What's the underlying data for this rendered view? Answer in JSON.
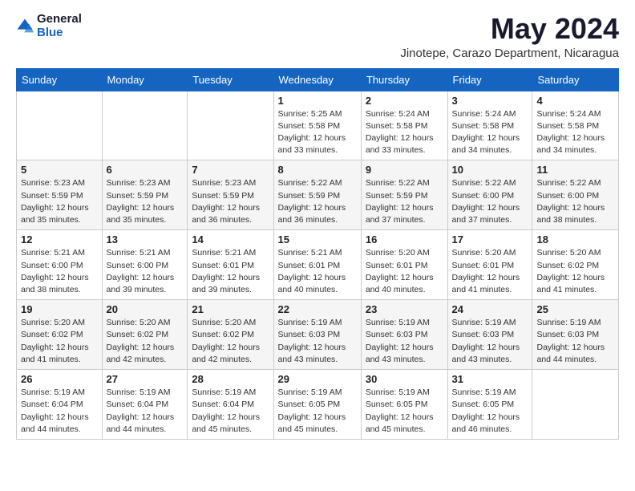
{
  "logo": {
    "general": "General",
    "blue": "Blue"
  },
  "title": "May 2024",
  "location": "Jinotepe, Carazo Department, Nicaragua",
  "weekdays": [
    "Sunday",
    "Monday",
    "Tuesday",
    "Wednesday",
    "Thursday",
    "Friday",
    "Saturday"
  ],
  "weeks": [
    [
      {
        "day": "",
        "info": ""
      },
      {
        "day": "",
        "info": ""
      },
      {
        "day": "",
        "info": ""
      },
      {
        "day": "1",
        "info": "Sunrise: 5:25 AM\nSunset: 5:58 PM\nDaylight: 12 hours\nand 33 minutes."
      },
      {
        "day": "2",
        "info": "Sunrise: 5:24 AM\nSunset: 5:58 PM\nDaylight: 12 hours\nand 33 minutes."
      },
      {
        "day": "3",
        "info": "Sunrise: 5:24 AM\nSunset: 5:58 PM\nDaylight: 12 hours\nand 34 minutes."
      },
      {
        "day": "4",
        "info": "Sunrise: 5:24 AM\nSunset: 5:58 PM\nDaylight: 12 hours\nand 34 minutes."
      }
    ],
    [
      {
        "day": "5",
        "info": "Sunrise: 5:23 AM\nSunset: 5:59 PM\nDaylight: 12 hours\nand 35 minutes."
      },
      {
        "day": "6",
        "info": "Sunrise: 5:23 AM\nSunset: 5:59 PM\nDaylight: 12 hours\nand 35 minutes."
      },
      {
        "day": "7",
        "info": "Sunrise: 5:23 AM\nSunset: 5:59 PM\nDaylight: 12 hours\nand 36 minutes."
      },
      {
        "day": "8",
        "info": "Sunrise: 5:22 AM\nSunset: 5:59 PM\nDaylight: 12 hours\nand 36 minutes."
      },
      {
        "day": "9",
        "info": "Sunrise: 5:22 AM\nSunset: 5:59 PM\nDaylight: 12 hours\nand 37 minutes."
      },
      {
        "day": "10",
        "info": "Sunrise: 5:22 AM\nSunset: 6:00 PM\nDaylight: 12 hours\nand 37 minutes."
      },
      {
        "day": "11",
        "info": "Sunrise: 5:22 AM\nSunset: 6:00 PM\nDaylight: 12 hours\nand 38 minutes."
      }
    ],
    [
      {
        "day": "12",
        "info": "Sunrise: 5:21 AM\nSunset: 6:00 PM\nDaylight: 12 hours\nand 38 minutes."
      },
      {
        "day": "13",
        "info": "Sunrise: 5:21 AM\nSunset: 6:00 PM\nDaylight: 12 hours\nand 39 minutes."
      },
      {
        "day": "14",
        "info": "Sunrise: 5:21 AM\nSunset: 6:01 PM\nDaylight: 12 hours\nand 39 minutes."
      },
      {
        "day": "15",
        "info": "Sunrise: 5:21 AM\nSunset: 6:01 PM\nDaylight: 12 hours\nand 40 minutes."
      },
      {
        "day": "16",
        "info": "Sunrise: 5:20 AM\nSunset: 6:01 PM\nDaylight: 12 hours\nand 40 minutes."
      },
      {
        "day": "17",
        "info": "Sunrise: 5:20 AM\nSunset: 6:01 PM\nDaylight: 12 hours\nand 41 minutes."
      },
      {
        "day": "18",
        "info": "Sunrise: 5:20 AM\nSunset: 6:02 PM\nDaylight: 12 hours\nand 41 minutes."
      }
    ],
    [
      {
        "day": "19",
        "info": "Sunrise: 5:20 AM\nSunset: 6:02 PM\nDaylight: 12 hours\nand 41 minutes."
      },
      {
        "day": "20",
        "info": "Sunrise: 5:20 AM\nSunset: 6:02 PM\nDaylight: 12 hours\nand 42 minutes."
      },
      {
        "day": "21",
        "info": "Sunrise: 5:20 AM\nSunset: 6:02 PM\nDaylight: 12 hours\nand 42 minutes."
      },
      {
        "day": "22",
        "info": "Sunrise: 5:19 AM\nSunset: 6:03 PM\nDaylight: 12 hours\nand 43 minutes."
      },
      {
        "day": "23",
        "info": "Sunrise: 5:19 AM\nSunset: 6:03 PM\nDaylight: 12 hours\nand 43 minutes."
      },
      {
        "day": "24",
        "info": "Sunrise: 5:19 AM\nSunset: 6:03 PM\nDaylight: 12 hours\nand 43 minutes."
      },
      {
        "day": "25",
        "info": "Sunrise: 5:19 AM\nSunset: 6:03 PM\nDaylight: 12 hours\nand 44 minutes."
      }
    ],
    [
      {
        "day": "26",
        "info": "Sunrise: 5:19 AM\nSunset: 6:04 PM\nDaylight: 12 hours\nand 44 minutes."
      },
      {
        "day": "27",
        "info": "Sunrise: 5:19 AM\nSunset: 6:04 PM\nDaylight: 12 hours\nand 44 minutes."
      },
      {
        "day": "28",
        "info": "Sunrise: 5:19 AM\nSunset: 6:04 PM\nDaylight: 12 hours\nand 45 minutes."
      },
      {
        "day": "29",
        "info": "Sunrise: 5:19 AM\nSunset: 6:05 PM\nDaylight: 12 hours\nand 45 minutes."
      },
      {
        "day": "30",
        "info": "Sunrise: 5:19 AM\nSunset: 6:05 PM\nDaylight: 12 hours\nand 45 minutes."
      },
      {
        "day": "31",
        "info": "Sunrise: 5:19 AM\nSunset: 6:05 PM\nDaylight: 12 hours\nand 46 minutes."
      },
      {
        "day": "",
        "info": ""
      }
    ]
  ]
}
